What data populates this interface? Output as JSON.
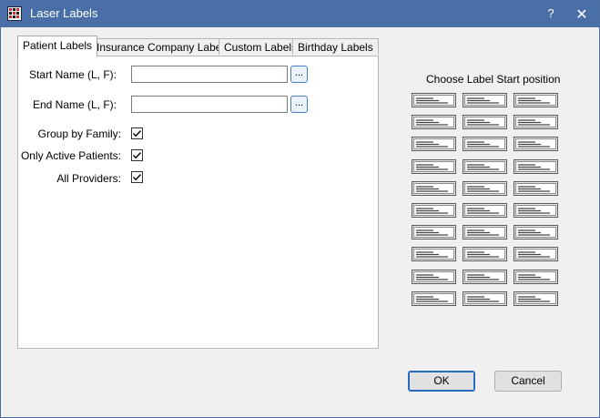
{
  "window": {
    "title": "Laser Labels",
    "help_label": "?",
    "close_label": "✕"
  },
  "tabs": [
    {
      "label": "Patient Labels",
      "active": true
    },
    {
      "label": "Insurance Company Labels",
      "active": false
    },
    {
      "label": "Custom Labels",
      "active": false
    },
    {
      "label": "Birthday Labels",
      "active": false
    }
  ],
  "patient_tab": {
    "start_name_label": "Start Name (L, F):",
    "start_name_value": "",
    "end_name_label": "End Name (L, F):",
    "end_name_value": "",
    "browse_label": "...",
    "group_by_family_label": "Group by Family:",
    "group_by_family_checked": true,
    "only_active_label": "Only Active Patients:",
    "only_active_checked": true,
    "all_providers_label": "All Providers:",
    "all_providers_checked": true
  },
  "label_grid": {
    "title": "Choose Label Start position",
    "rows": 10,
    "columns": 3,
    "icon": "label-sheet-icon"
  },
  "buttons": {
    "ok_label": "OK",
    "cancel_label": "Cancel"
  },
  "colors": {
    "titlebar": "#4a6fa8",
    "accent": "#2a6bc0"
  }
}
